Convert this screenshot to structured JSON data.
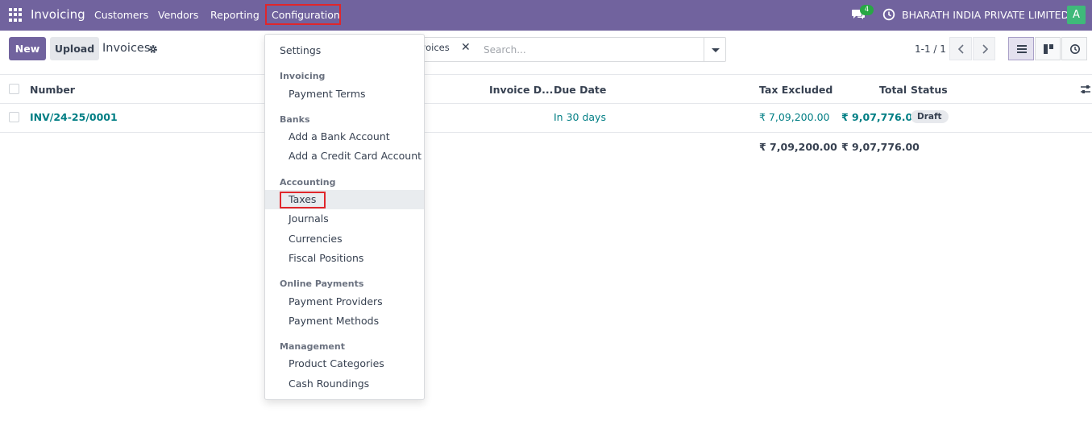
{
  "navbar": {
    "brand": "Invoicing",
    "menu": [
      "Customers",
      "Vendors",
      "Reporting",
      "Configuration"
    ],
    "chat_count": "4",
    "company": "BHARATH INDIA PRIVATE LIMITED",
    "avatar_letter": "A"
  },
  "control": {
    "new_label": "New",
    "upload_label": "Upload",
    "title": "Invoices",
    "facet_label": "nvoices",
    "search_placeholder": "Search...",
    "pager": "1-1 / 1"
  },
  "table": {
    "columns": [
      "Number",
      "Invoice D...",
      "Due Date",
      "Tax Excluded",
      "Total",
      "Status"
    ],
    "rows": [
      {
        "number": "INV/24-25/0001",
        "due_date": "In 30 days",
        "tax_excluded": "₹ 7,09,200.00",
        "total": "₹ 9,07,776.00",
        "status": "Draft"
      }
    ],
    "totals": {
      "tax_excluded": "₹ 7,09,200.00",
      "total": "₹ 9,07,776.00"
    }
  },
  "dropdown": {
    "settings": "Settings",
    "sections": [
      {
        "header": "Invoicing",
        "items": [
          "Payment Terms"
        ]
      },
      {
        "header": "Banks",
        "items": [
          "Add a Bank Account",
          "Add a Credit Card Account"
        ]
      },
      {
        "header": "Accounting",
        "items": [
          "Taxes",
          "Journals",
          "Currencies",
          "Fiscal Positions"
        ]
      },
      {
        "header": "Online Payments",
        "items": [
          "Payment Providers",
          "Payment Methods"
        ]
      },
      {
        "header": "Management",
        "items": [
          "Product Categories",
          "Cash Roundings"
        ]
      }
    ]
  },
  "colors": {
    "brand": "#71639e",
    "link": "#017e84",
    "highlight_box": "#e0262b"
  }
}
